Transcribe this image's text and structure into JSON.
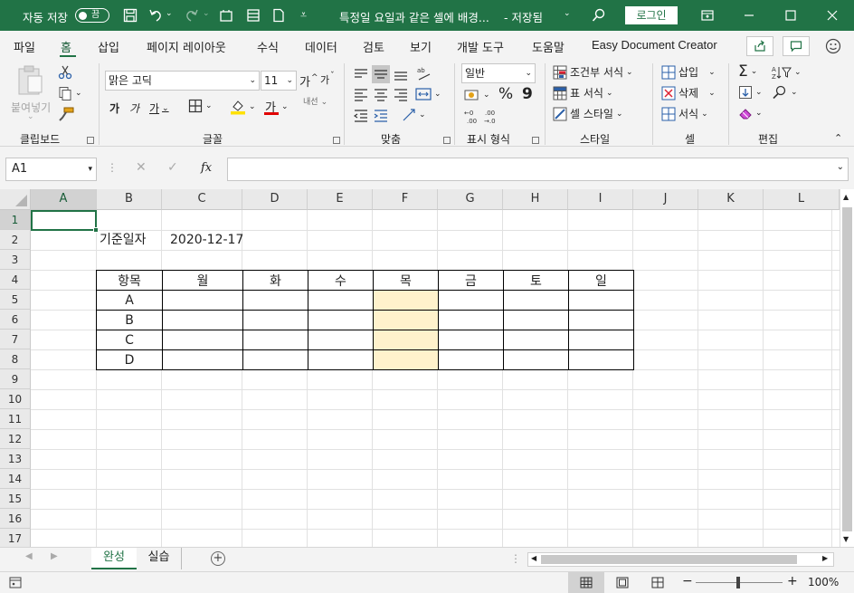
{
  "titlebar": {
    "autosave_label": "자동 저장",
    "autosave_state": "끔",
    "doc_title": "특정일 요일과 같은 셀에 배경...",
    "save_status": "- 저장됨",
    "login_label": "로그인",
    "bg_color": "#217346"
  },
  "tabs": [
    "파일",
    "홈",
    "삽입",
    "페이지 레이아웃",
    "수식",
    "데이터",
    "검토",
    "보기",
    "개발 도구",
    "도움말",
    "Easy Document Creator"
  ],
  "ribbon": {
    "paste_label": "붙여넣기",
    "clipboard_label": "클립보드",
    "font_name": "맑은 고딕",
    "font_size": "11",
    "font_group_label": "글꼴",
    "align_group_label": "맞춤",
    "number_format": "일반",
    "number_group_label": "표시 형식",
    "cond_format": "조건부 서식",
    "table_format": "표 서식",
    "cell_style": "셀 스타일",
    "style_group_label": "스타일",
    "insert_label": "삽입",
    "delete_label": "삭제",
    "format_label": "서식",
    "cells_group_label": "셀",
    "edit_group_label": "편집",
    "bold": "가",
    "italic": "가",
    "underline": "가",
    "grow_font": "가",
    "shrink_font": "가",
    "font_color_glyph": "가",
    "wrap_glyph": "내선"
  },
  "formula_bar": {
    "name_box": "A1",
    "fx_label": "fx",
    "formula_value": ""
  },
  "columns": [
    "A",
    "B",
    "C",
    "D",
    "E",
    "F",
    "G",
    "H",
    "I",
    "J",
    "K",
    "L"
  ],
  "rows": [
    "1",
    "2",
    "3",
    "4",
    "5",
    "6",
    "7",
    "8",
    "9",
    "10",
    "11",
    "12",
    "13",
    "14",
    "15",
    "16",
    "17"
  ],
  "cells": {
    "B2": "기준일자",
    "C2": "2020-12-17"
  },
  "schedule_table": {
    "header": [
      "항목",
      "월",
      "화",
      "수",
      "목",
      "금",
      "토",
      "일"
    ],
    "items": [
      "A",
      "B",
      "C",
      "D"
    ],
    "highlight_color": "#fff2cc"
  },
  "sheets": [
    "완성",
    "실습"
  ],
  "status": {
    "zoom": "100%"
  }
}
